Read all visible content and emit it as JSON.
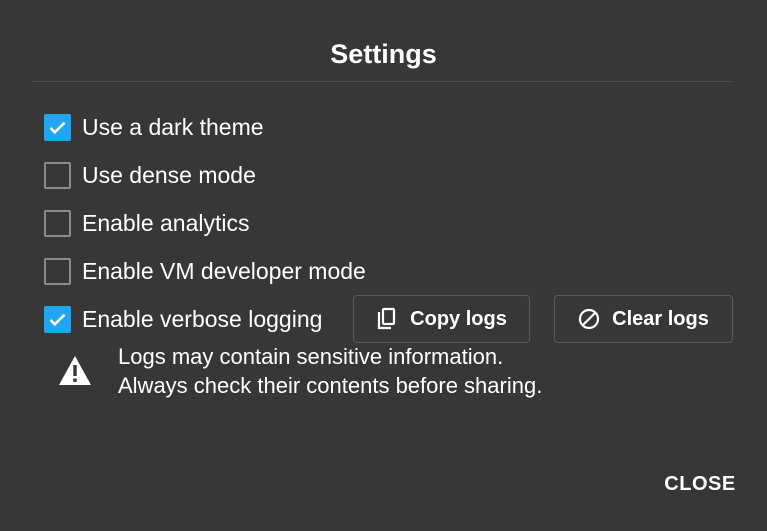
{
  "dialog": {
    "title": "Settings"
  },
  "options": [
    {
      "label": "Use a dark theme",
      "checked": true
    },
    {
      "label": "Use dense mode",
      "checked": false
    },
    {
      "label": "Enable analytics",
      "checked": false
    },
    {
      "label": "Enable VM developer mode",
      "checked": false
    },
    {
      "label": "Enable verbose logging",
      "checked": true
    }
  ],
  "buttons": {
    "copy_logs": "Copy logs",
    "clear_logs": "Clear logs",
    "close": "CLOSE"
  },
  "warning": {
    "line1": "Logs may contain sensitive information.",
    "line2": "Always check their contents before sharing."
  },
  "colors": {
    "background": "#373737",
    "accent": "#1ea6f0"
  },
  "icons": {
    "checkbox_checked": "check-icon",
    "copy": "copy-icon",
    "clear": "block-icon",
    "warning": "warning-icon"
  }
}
